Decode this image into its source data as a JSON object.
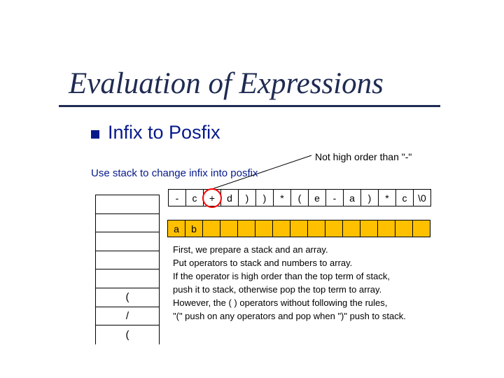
{
  "title": "Evaluation of Expressions",
  "sub_title": "Infix to Posfix",
  "annotation": "Not high order than \"-\"",
  "instruction": "Use stack to change infix into posfix",
  "infix_cells": [
    "-",
    "c",
    "+",
    "d",
    ")",
    ")",
    "*",
    "(",
    "e",
    "-",
    "a",
    ")",
    "*",
    "c",
    "\\0"
  ],
  "highlight_index": 2,
  "output_cells": [
    "a",
    "b",
    "",
    "",
    "",
    "",
    "",
    "",
    "",
    "",
    "",
    "",
    "",
    "",
    ""
  ],
  "stack_cells": [
    "",
    "",
    "",
    "",
    "",
    "(",
    "/",
    "("
  ],
  "explain_lines": [
    "First, we prepare a stack and an array.",
    " Put operators to stack and numbers to array.",
    " If the operator is high order than the top term of stack,",
    " push it to stack, otherwise pop the top term to array.",
    " However, the ( ) operators without following the rules,",
    " \"(\" push on any operators and pop when \")\" push to stack."
  ]
}
